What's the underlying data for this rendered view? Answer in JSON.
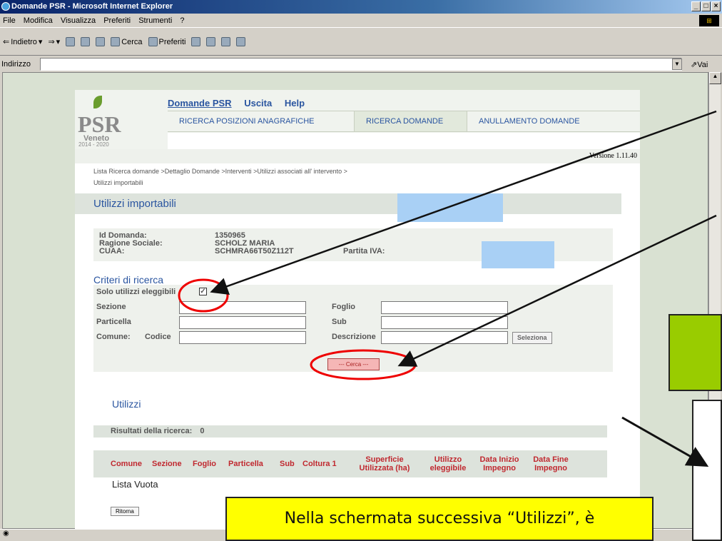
{
  "window": {
    "title": "Domande PSR - Microsoft Internet Explorer"
  },
  "menubar": {
    "items": [
      "File",
      "Modifica",
      "Visualizza",
      "Preferiti",
      "Strumenti",
      "?"
    ]
  },
  "toolbar": {
    "back": "Indietro",
    "search": "Cerca",
    "favorites": "Preferiti"
  },
  "address": {
    "label": "Indirizzo",
    "value": "",
    "go": "Vai"
  },
  "logo": {
    "text": "PSR",
    "region": "Veneto",
    "years": "2014 - 2020"
  },
  "nav": {
    "items": [
      "Domande PSR",
      "Uscita",
      "Help"
    ]
  },
  "tabs": [
    "RICERCA POSIZIONI ANAGRAFICHE",
    "RICERCA DOMANDE",
    "ANULLAMENTO DOMANDE"
  ],
  "version": "Versione 1.11.40",
  "breadcrumb": {
    "line1": "Lista Ricerca domande >Dettaglio Domande >Interventi >Utilizzi associati all' intervento >",
    "line2": "Utilizzi importabili"
  },
  "page_title": "Utilizzi importabili",
  "info": {
    "id_label": "Id Domanda:",
    "id_value": "1350965",
    "rs_label": "Ragione Sociale:",
    "rs_value": "SCHOLZ MARIA",
    "cuaa_label": "CUAA:",
    "cuaa_value": "SCHMRA66T50Z112T",
    "piva_label": "Partita IVA:"
  },
  "search": {
    "title": "Criteri di ricerca",
    "solo_label": "Solo utilizzi eleggibili",
    "solo_checked": true,
    "sezione": "Sezione",
    "foglio": "Foglio",
    "particella": "Particella",
    "sub": "Sub",
    "comune": "Comune:",
    "codice": "Codice",
    "descrizione": "Descrizione",
    "seleziona": "Seleziona",
    "cerca": "--- Cerca ---"
  },
  "utilizzi": {
    "title": "Utilizzi",
    "results_label": "Risultati della ricerca:",
    "results_count": "0",
    "columns": [
      "Comune",
      "Sezione",
      "Foglio",
      "Particella",
      "Sub",
      "Coltura 1",
      "Superficie Utilizzata (ha)",
      "Utilizzo eleggibile",
      "Data Inizio Impegno",
      "Data Fine Impegno"
    ],
    "empty": "Lista Vuota",
    "ritorna": "Ritorna"
  },
  "callout": {
    "text": "Nella schermata successiva “Utilizzi”, è"
  }
}
